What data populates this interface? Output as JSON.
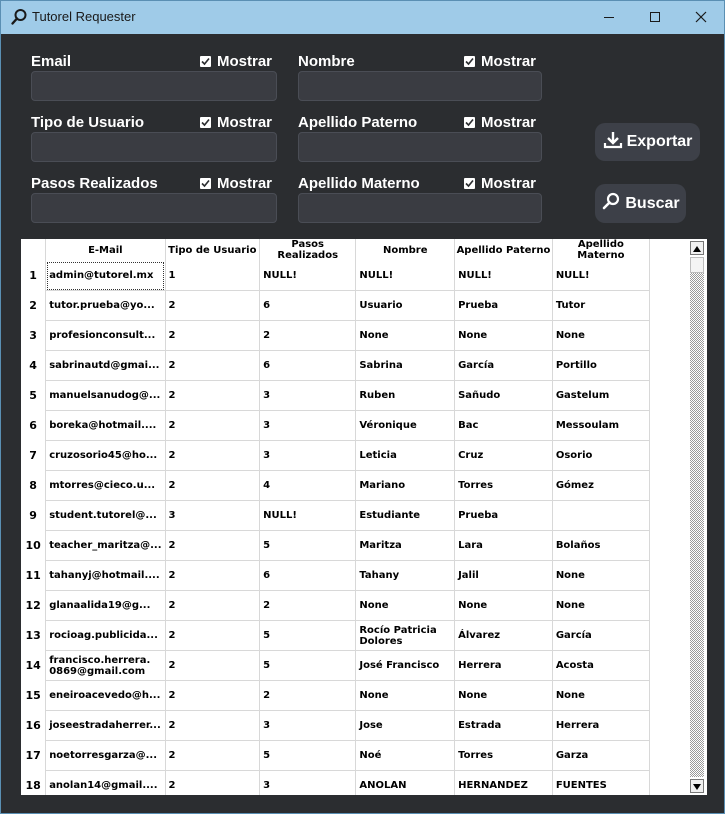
{
  "window": {
    "title": "Tutorel Requester"
  },
  "filters": {
    "show_label": "Mostrar",
    "email": {
      "label": "Email",
      "value": ""
    },
    "nombre": {
      "label": "Nombre",
      "value": ""
    },
    "tipo_usuario": {
      "label": "Tipo de Usuario",
      "value": ""
    },
    "apellido_paterno": {
      "label": "Apellido Paterno",
      "value": ""
    },
    "pasos_realizados": {
      "label": "Pasos Realizados",
      "value": ""
    },
    "apellido_materno": {
      "label": "Apellido Materno",
      "value": ""
    }
  },
  "actions": {
    "export_label": "Exportar",
    "search_label": "Buscar"
  },
  "table": {
    "columns": [
      "E-Mail",
      "Tipo de Usuario",
      "Pasos Realizados",
      "Nombre",
      "Apellido Paterno",
      "Apellido Materno"
    ],
    "rows": [
      [
        "1",
        "admin@tutorel.mx",
        "1",
        "NULL!",
        "NULL!",
        "NULL!",
        "NULL!"
      ],
      [
        "2",
        "tutor.prueba@yo...",
        "2",
        "6",
        "Usuario",
        "Prueba",
        "Tutor"
      ],
      [
        "3",
        "profesionconsult...",
        "2",
        "2",
        "None",
        "None",
        "None"
      ],
      [
        "4",
        "sabrinautd@gmai...",
        "2",
        "6",
        "Sabrina",
        "García",
        "Portillo"
      ],
      [
        "5",
        "manuelsanudog@...",
        "2",
        "3",
        "Ruben",
        "Sañudo",
        "Gastelum"
      ],
      [
        "6",
        "boreka@hotmail....",
        "2",
        "3",
        "Véronique",
        "Bac",
        "Messoulam"
      ],
      [
        "7",
        "cruzosorio45@ho...",
        "2",
        "3",
        "Leticia",
        "Cruz",
        "Osorio"
      ],
      [
        "8",
        "mtorres@cieco.u...",
        "2",
        "4",
        "Mariano",
        "Torres",
        "Gómez"
      ],
      [
        "9",
        "student.tutorel@...",
        "3",
        "NULL!",
        "Estudiante",
        "Prueba",
        ""
      ],
      [
        "10",
        "teacher_maritza@...",
        "2",
        "5",
        "Maritza",
        "Lara",
        "Bolaños"
      ],
      [
        "11",
        "tahanyj@hotmail....",
        "2",
        "6",
        "Tahany",
        "Jalil",
        "None"
      ],
      [
        "12",
        "glanaalida19@g...",
        "2",
        "2",
        "None",
        "None",
        "None"
      ],
      [
        "13",
        "rocioag.publicida...",
        "2",
        "5",
        "Rocío Patricia Dolores",
        "Álvarez",
        "García"
      ],
      [
        "14",
        "francisco.herrera. 0869@gmail.com",
        "2",
        "5",
        "José Francisco",
        "Herrera",
        "Acosta"
      ],
      [
        "15",
        "eneiroacevedo@h...",
        "2",
        "2",
        "None",
        "None",
        "None"
      ],
      [
        "16",
        "joseestradaherrer...",
        "2",
        "3",
        "Jose",
        "Estrada",
        "Herrera"
      ],
      [
        "17",
        "noetorresgarza@...",
        "2",
        "5",
        "Noé",
        "Torres",
        "Garza"
      ],
      [
        "18",
        "anolan14@gmail....",
        "2",
        "3",
        "ANOLAN",
        "HERNANDEZ",
        "FUENTES"
      ]
    ]
  },
  "icons": {
    "app": "magnifier-icon",
    "minimize": "minimize-icon",
    "maximize": "maximize-icon",
    "close": "close-icon",
    "export": "download-icon",
    "search": "magnifier-icon",
    "checkbox": "checkmark-icon"
  },
  "colors": {
    "titlebar": "#9fcbe8",
    "background": "#2b2d30",
    "input": "#3a3c42",
    "button": "#3d4048"
  }
}
